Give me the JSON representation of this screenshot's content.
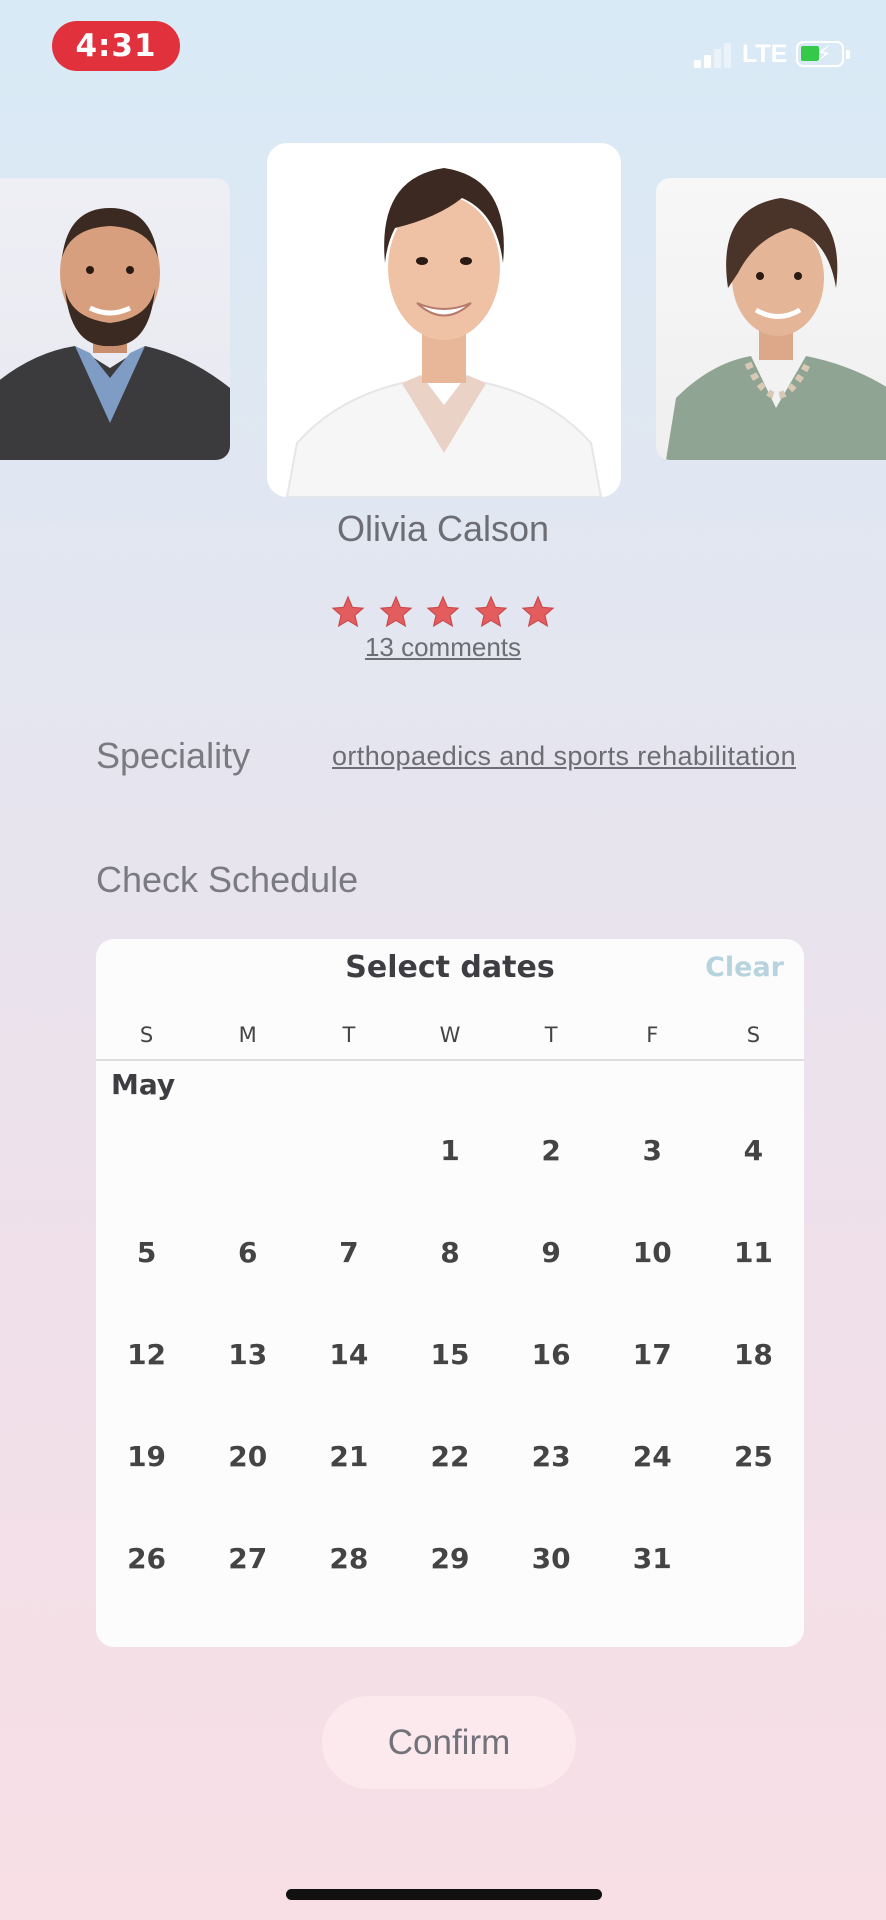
{
  "status_bar": {
    "time": "4:31",
    "network": "LTE",
    "signal_bars_active": 2,
    "signal_bars_total": 4,
    "battery_charging": true,
    "time_pill_color": "#e0313d"
  },
  "carousel": {
    "doctors": [
      {
        "position": "left",
        "icon": "doctor-photo"
      },
      {
        "position": "center",
        "icon": "doctor-photo",
        "selected": true
      },
      {
        "position": "right",
        "icon": "doctor-photo"
      }
    ]
  },
  "doctor": {
    "name": "Olivia Calson",
    "rating": 5,
    "rating_max": 5,
    "comments_label": "13 comments",
    "star_color": "#e35d5f"
  },
  "details": {
    "speciality_label": "Speciality",
    "speciality_value": "orthopaedics and sports rehabilitation",
    "schedule_label": "Check Schedule"
  },
  "calendar": {
    "title": "Select dates",
    "clear_label": "Clear",
    "weekdays": [
      "S",
      "M",
      "T",
      "W",
      "T",
      "F",
      "S"
    ],
    "month": "May",
    "first_weekday_index": 3,
    "days": [
      "1",
      "2",
      "3",
      "4",
      "5",
      "6",
      "7",
      "8",
      "9",
      "10",
      "11",
      "12",
      "13",
      "14",
      "15",
      "16",
      "17",
      "18",
      "19",
      "20",
      "21",
      "22",
      "23",
      "24",
      "25",
      "26",
      "27",
      "28",
      "29",
      "30",
      "31"
    ]
  },
  "actions": {
    "confirm_label": "Confirm"
  }
}
